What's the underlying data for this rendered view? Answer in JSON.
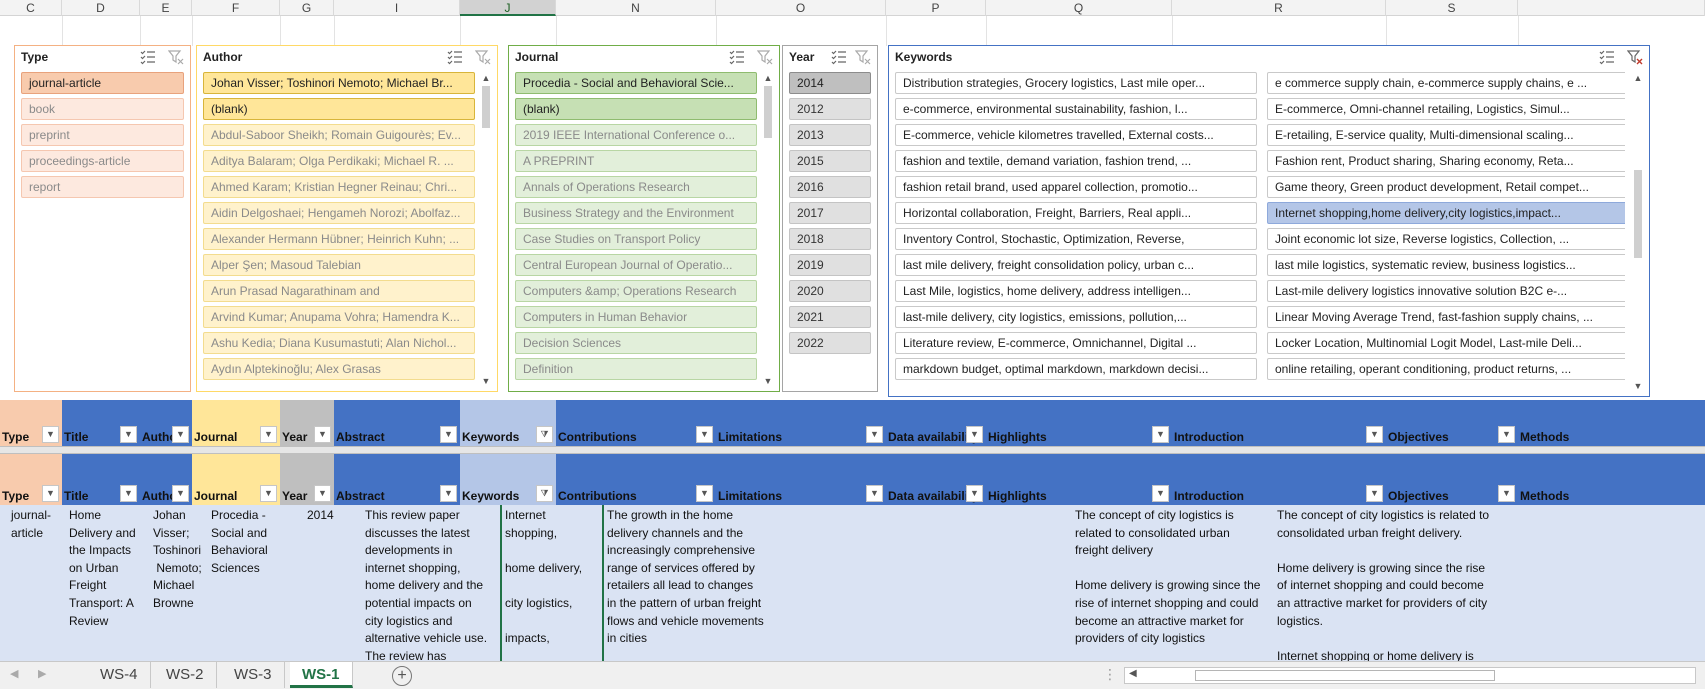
{
  "columns": [
    "C",
    "D",
    "E",
    "F",
    "G",
    "I",
    "J",
    "N",
    "O",
    "P",
    "Q",
    "R",
    "S"
  ],
  "slicers": {
    "type": {
      "title": "Type",
      "items": [
        {
          "label": "journal-article",
          "state": "selected"
        },
        {
          "label": "book",
          "state": "dim"
        },
        {
          "label": "preprint",
          "state": "dim"
        },
        {
          "label": "proceedings-article",
          "state": "dim"
        },
        {
          "label": "report",
          "state": "dim"
        }
      ]
    },
    "author": {
      "title": "Author",
      "items": [
        {
          "label": "Johan Visser; Toshinori Nemoto; Michael Br...",
          "state": "selected"
        },
        {
          "label": "(blank)",
          "state": "selected"
        },
        {
          "label": "Abdul-Saboor Sheikh; Romain Guigourès; Ev...",
          "state": "dim"
        },
        {
          "label": "Aditya Balaram; Olga Perdikaki; Michael R. ...",
          "state": "dim"
        },
        {
          "label": "Ahmed Karam; Kristian Hegner Reinau; Chri...",
          "state": "dim"
        },
        {
          "label": "Aidin Delgoshaei; Hengameh Norozi; Abolfaz...",
          "state": "dim"
        },
        {
          "label": "Alexander Hermann Hübner; Heinrich Kuhn; ...",
          "state": "dim"
        },
        {
          "label": "Alper Şen; Masoud Talebian",
          "state": "dim"
        },
        {
          "label": "Arun Prasad Nagarathinam and",
          "state": "dim"
        },
        {
          "label": "Arvind Kumar; Anupama Vohra; Hamendra K...",
          "state": "dim"
        },
        {
          "label": "Ashu Kedia; Diana Kusumastuti; Alan Nichol...",
          "state": "dim"
        },
        {
          "label": "Aydın Alptekinoğlu; Alex Grasas",
          "state": "dim"
        }
      ]
    },
    "journal": {
      "title": "Journal",
      "items": [
        {
          "label": "Procedia - Social and Behavioral Scie...",
          "state": "selected"
        },
        {
          "label": "(blank)",
          "state": "selected"
        },
        {
          "label": "2019 IEEE International Conference o...",
          "state": "dim"
        },
        {
          "label": "A PREPRINT",
          "state": "dim"
        },
        {
          "label": "Annals of Operations Research",
          "state": "dim"
        },
        {
          "label": "Business Strategy and the Environment",
          "state": "dim"
        },
        {
          "label": "Case Studies on Transport Policy",
          "state": "dim"
        },
        {
          "label": "Central European Journal of Operatio...",
          "state": "dim"
        },
        {
          "label": "Computers &amp; Operations Research",
          "state": "dim"
        },
        {
          "label": "Computers in Human Behavior",
          "state": "dim"
        },
        {
          "label": "Decision Sciences",
          "state": "dim"
        },
        {
          "label": "Definition",
          "state": "dim"
        }
      ]
    },
    "year": {
      "title": "Year",
      "items": [
        {
          "label": "2014",
          "state": "selected"
        },
        {
          "label": "2012",
          "state": "dim"
        },
        {
          "label": "2013",
          "state": "dim"
        },
        {
          "label": "2015",
          "state": "dim"
        },
        {
          "label": "2016",
          "state": "dim"
        },
        {
          "label": "2017",
          "state": "dim"
        },
        {
          "label": "2018",
          "state": "dim"
        },
        {
          "label": "2019",
          "state": "dim"
        },
        {
          "label": "2020",
          "state": "dim"
        },
        {
          "label": "2021",
          "state": "dim"
        },
        {
          "label": "2022",
          "state": "dim"
        }
      ]
    },
    "keywords": {
      "title": "Keywords",
      "left": [
        "Distribution strategies, Grocery logistics, Last mile oper...",
        "e-commerce, environmental sustainability, fashion, l...",
        "E-commerce, vehicle kilometres travelled, External costs...",
        "fashion and textile, demand variation, fashion trend, ...",
        "fashion retail brand, used apparel collection, promotio...",
        "Horizontal collaboration, Freight, Barriers, Real appli...",
        "Inventory Control, Stochastic, Optimization, Reverse,",
        "last mile delivery, freight consolidation policy, urban c...",
        "Last Mile, logistics, home delivery, address intelligen...",
        "last-mile delivery, city logistics, emissions, pollution,...",
        "Literature review, E-commerce, Omnichannel, Digital ...",
        "markdown budget, optimal markdown, markdown decisi..."
      ],
      "right": [
        "e commerce supply chain, e-commerce supply chains, e ...",
        "E-commerce, Omni-channel retailing, Logistics, Simul...",
        "E-retailing, E-service quality, Multi-dimensional scaling...",
        "Fashion rent, Product sharing, Sharing economy, Reta...",
        "Game theory, Green product development, Retail compet...",
        "Internet shopping,home delivery,city logistics,impact...",
        "Joint economic lot size, Reverse logistics, Collection, ...",
        "last mile logistics, systematic review, business logistics...",
        "Last-mile delivery logistics innovative solution B2C e-...",
        "Linear Moving Average Trend, fast-fashion supply chains, ...",
        "Locker Location, Multinomial Logit Model, Last-mile Deli...",
        "online retailing, operant conditioning, product returns, ..."
      ],
      "selected_right_index": 5
    }
  },
  "table_headers": [
    "Type",
    "Title",
    "Autho",
    "Journal",
    "Year",
    "Abstract",
    "Keywords",
    "Contributions",
    "Limitations",
    "Data availability",
    "Highlights",
    "Introduction",
    "Objectives",
    "Methods"
  ],
  "data_row": {
    "type": "journal-\narticle",
    "title": "Home\nDelivery and\nthe Impacts\non Urban\nFreight\nTransport: A\nReview",
    "author": "Johan\nVisser;\nToshinori\n Nemoto;\nMichael\nBrowne",
    "journal": "Procedia -\nSocial and\nBehavioral\nSciences",
    "year": "2014",
    "abstract": "This review paper\ndiscusses the latest\ndevelopments in\ninternet shopping,\nhome delivery and the\npotential impacts on\ncity logistics and\nalternative vehicle use.\nThe review has",
    "keywords": "Internet\nshopping,\n\nhome delivery,\n\ncity logistics,\n\nimpacts,",
    "contributions": "The growth in the home\ndelivery channels and the\nincreasingly comprehensive\nrange of services offered by\nretailers all lead to changes\nin the pattern of urban freight\nflows and vehicle movements\nin cities",
    "limitations": "",
    "data_availability": "",
    "highlights": "The concept of city logistics is\nrelated to consolidated urban\nfreight delivery\n\nHome delivery is growing since the\nrise of internet shopping and could\nbecome an attractive market for\nproviders of city logistics",
    "introduction": "The concept of city logistics is related to\nconsolidated urban freight delivery.\n\nHome delivery is growing since the rise\nof internet shopping and could become\nan attractive market for providers of city\nlogistics.\n\nInternet shopping or home delivery is",
    "objectives": "",
    "methods": ""
  },
  "sheet_tabs": [
    "WS-4",
    "WS-2",
    "WS-3",
    "WS-1"
  ],
  "active_tab": "WS-1",
  "add_sheet_symbol": "+",
  "colors": {
    "header_blue": "#4472c4",
    "row_fill": "#dae3f3",
    "type_orange": "#f4b183",
    "journal_yellow": "#ffe699",
    "year_gray": "#bfbfbf",
    "keywords_light": "#b4c6e7",
    "active_tab_green": "#217346"
  }
}
